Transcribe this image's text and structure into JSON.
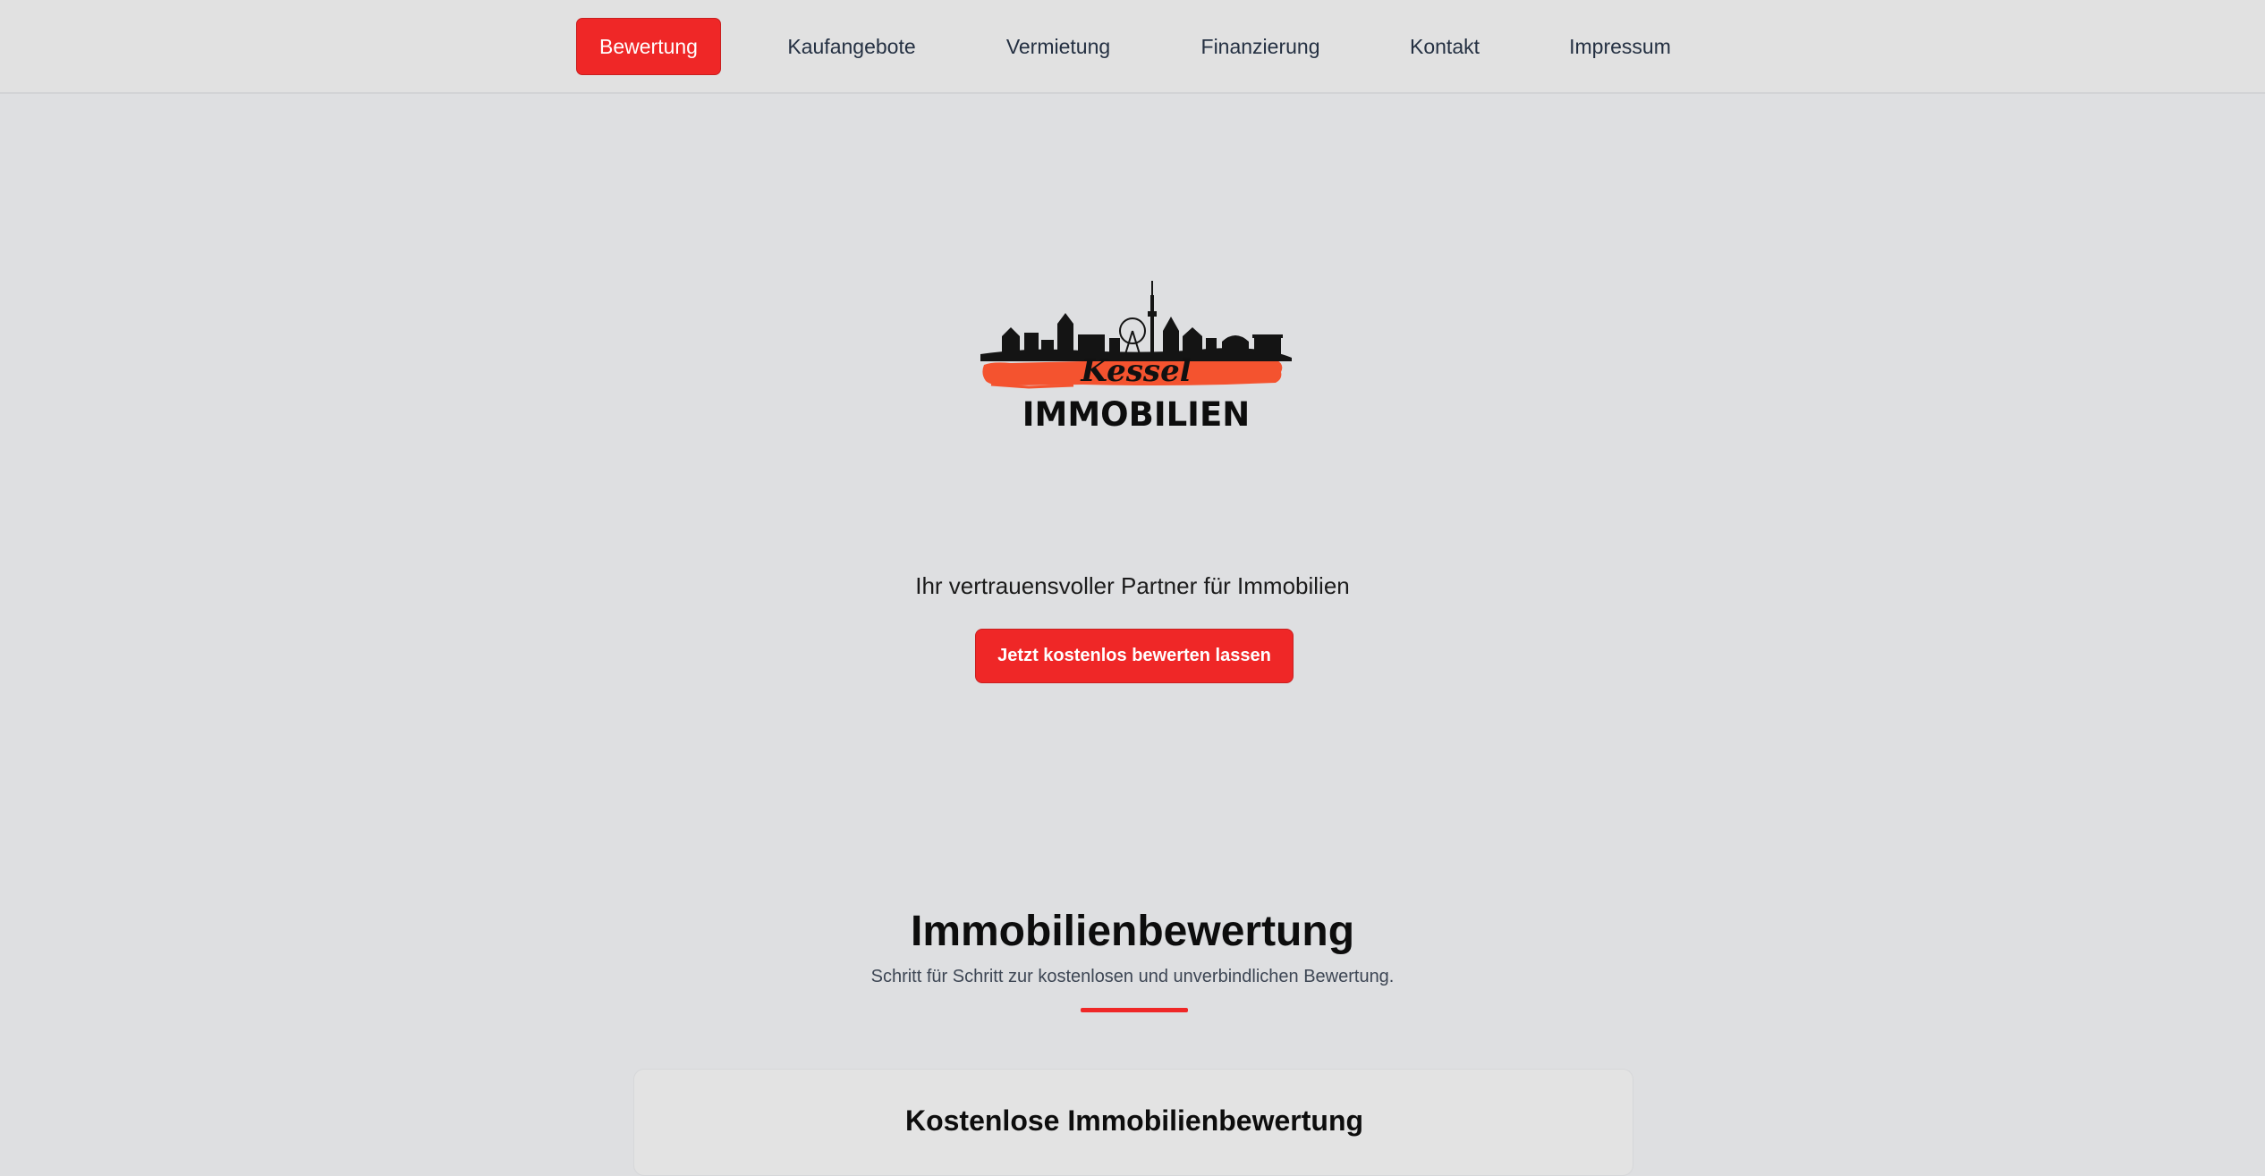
{
  "nav": {
    "items": [
      {
        "label": "Bewertung",
        "active": true
      },
      {
        "label": "Kaufangebote",
        "active": false
      },
      {
        "label": "Vermietung",
        "active": false
      },
      {
        "label": "Finanzierung",
        "active": false
      },
      {
        "label": "Kontakt",
        "active": false
      },
      {
        "label": "Impressum",
        "active": false
      }
    ]
  },
  "logo": {
    "script_text": "Kessel",
    "wordmark": "IMMOBILIEN",
    "icon": "city-skyline-icon"
  },
  "hero": {
    "tagline": "Ihr vertrauensvoller Partner für Immobilien",
    "cta_label": "Jetzt kostenlos bewerten lassen"
  },
  "section": {
    "title": "Immobilienbewertung",
    "subtitle": "Schritt für Schritt zur kostenlosen und unverbindlichen Bewertung."
  },
  "card": {
    "title": "Kostenlose Immobilienbewertung"
  },
  "colors": {
    "accent": "#ef2727",
    "background": "#dedfe1",
    "nav_background": "#e1e1e1"
  }
}
